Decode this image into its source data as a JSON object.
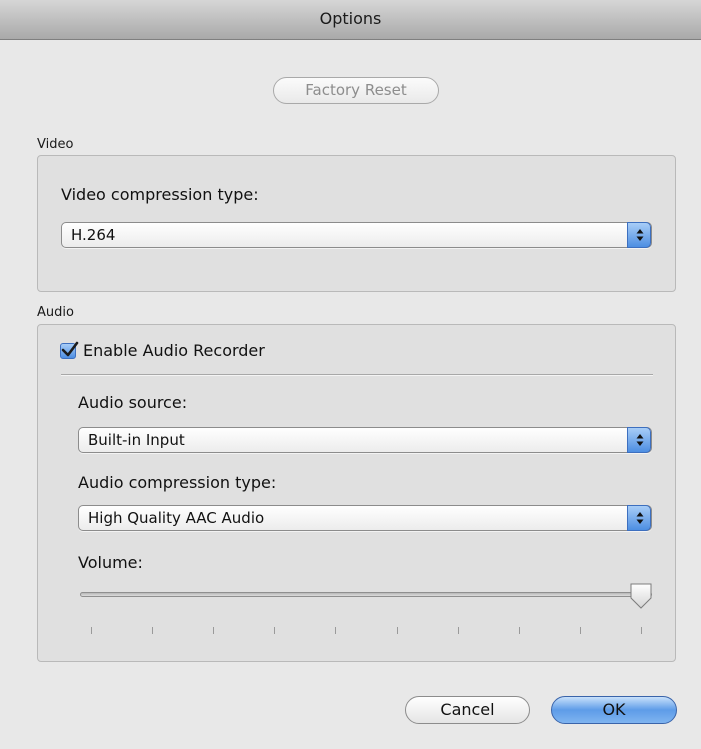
{
  "window": {
    "title": "Options"
  },
  "toolbar": {
    "factory_reset_label": "Factory Reset"
  },
  "video": {
    "section_label": "Video",
    "compression_label": "Video compression type:",
    "compression_value": "H.264"
  },
  "audio": {
    "section_label": "Audio",
    "enable_label": "Enable Audio Recorder",
    "enable_checked": true,
    "source_label": "Audio source:",
    "source_value": "Built-in Input",
    "compression_label": "Audio compression type:",
    "compression_value": "High Quality AAC Audio",
    "volume_label": "Volume:",
    "volume_level": 1.0,
    "volume_tick_count": 10
  },
  "buttons": {
    "cancel_label": "Cancel",
    "ok_label": "OK"
  },
  "colors": {
    "accent_blue": "#5e9ce8",
    "background": "#e8e8e8"
  },
  "icons": {
    "popup_arrows": "up-down-arrows-icon",
    "checkbox_mark": "checkmark-icon",
    "slider_knob": "slider-knob-icon"
  }
}
